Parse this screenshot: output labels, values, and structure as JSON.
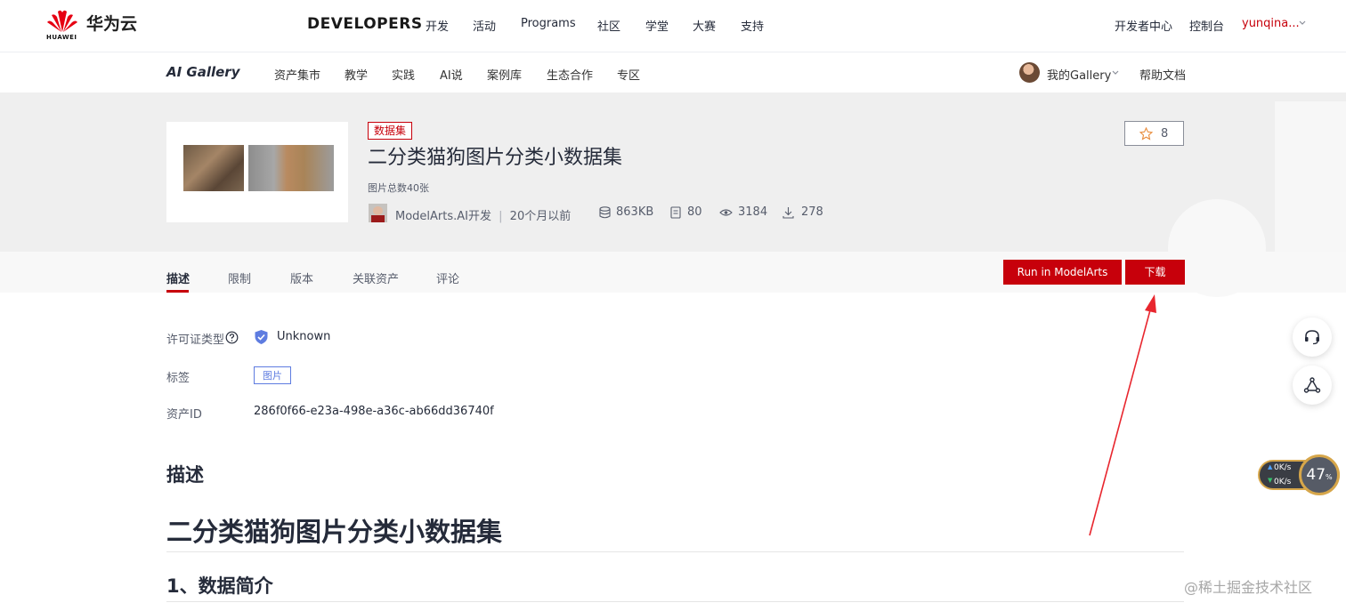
{
  "header": {
    "brand_cn": "华为云",
    "brand_en": "HUAWEI",
    "developers": "DEVELOPERS",
    "nav": [
      "开发",
      "活动",
      "Programs",
      "社区",
      "学堂",
      "大赛",
      "支持"
    ],
    "right": [
      "开发者中心",
      "控制台"
    ],
    "user": "yunqina..."
  },
  "subnav": {
    "gallery": "AI Gallery",
    "items": [
      "资产集市",
      "教学",
      "实践",
      "AI说",
      "案例库",
      "生态合作",
      "专区"
    ],
    "my_gallery": "我的Gallery",
    "help": "帮助文档"
  },
  "asset": {
    "badge": "数据集",
    "title": "二分类猫狗图片分类小数据集",
    "summary": "图片总数40张",
    "author": "ModelArts.AI开发",
    "time": "20个月以前",
    "size": "863KB",
    "files": "80",
    "views": "3184",
    "downloads": "278",
    "stars": "8"
  },
  "tabs": [
    "描述",
    "限制",
    "版本",
    "关联资产",
    "评论"
  ],
  "actions": {
    "run": "Run in ModelArts",
    "download": "下载"
  },
  "info": {
    "license_label": "许可证类型",
    "license_value": "Unknown",
    "tags_label": "标签",
    "tag": "图片",
    "id_label": "资产ID",
    "id_value": "286f0f66-e23a-498e-a36c-ab66dd36740f"
  },
  "content": {
    "section": "描述",
    "h1": "二分类猫狗图片分类小数据集",
    "h2": "1、数据简介"
  },
  "widget": {
    "up": "0K/s",
    "down": "0K/s",
    "percent": "47",
    "unit": "%"
  },
  "watermark": "@稀土掘金技术社区",
  "colors": {
    "brand_red": "#c7000b",
    "tag_blue": "#5e7ce0",
    "annotation_red": "#e8262e"
  }
}
